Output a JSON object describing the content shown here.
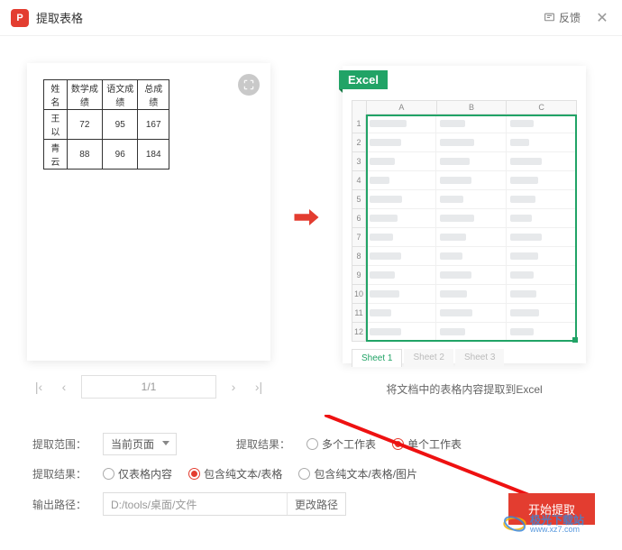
{
  "header": {
    "title": "提取表格",
    "feedback": "反馈"
  },
  "table": {
    "headers": [
      "姓名",
      "数学成绩",
      "语文成绩",
      "总成绩"
    ],
    "rows": [
      [
        "王以",
        "72",
        "95",
        "167"
      ],
      [
        "青云",
        "88",
        "96",
        "184"
      ]
    ]
  },
  "pager": {
    "value": "1/1"
  },
  "excel": {
    "tag": "Excel",
    "cols": [
      "A",
      "B",
      "C"
    ],
    "rows": [
      "1",
      "2",
      "3",
      "4",
      "5",
      "6",
      "7",
      "8",
      "9",
      "10",
      "11",
      "12"
    ],
    "tabs": [
      "Sheet 1",
      "Sheet 2",
      "Sheet 3"
    ]
  },
  "caption": "将文档中的表格内容提取到Excel",
  "scope": {
    "label": "提取范围：",
    "value": "当前页面"
  },
  "resultA": {
    "label": "提取结果：",
    "opt1": "多个工作表",
    "opt2": "单个工作表"
  },
  "resultB": {
    "label": "提取结果：",
    "opt1": "仅表格内容",
    "opt2": "包含纯文本/表格",
    "opt3": "包含纯文本/表格/图片"
  },
  "output": {
    "label": "输出路径：",
    "path": "D:/tools/桌面/文件",
    "change": "更改路径"
  },
  "action": {
    "extract": "开始提取"
  },
  "watermark": {
    "name": "极光下载站",
    "url": "www.xz7.com"
  }
}
